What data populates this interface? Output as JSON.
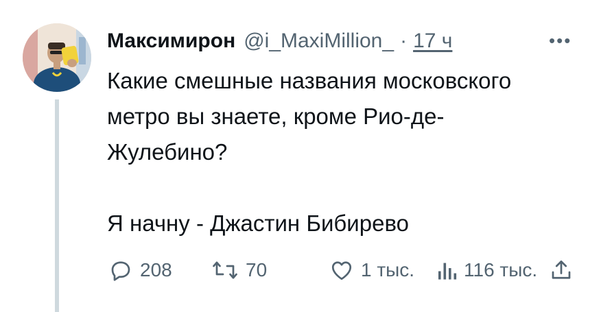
{
  "tweet": {
    "author_name": "Максимирон",
    "handle": "@i_MaxiMillion_",
    "separator": "·",
    "time": "17 ч",
    "more_label": "•••",
    "text_line1": "Какие смешные названия московского",
    "text_line2": "метро вы знаете, кроме Рио-де-",
    "text_line3": "Жулебино?",
    "text_line4": "Я начну - Джастин Бибирево"
  },
  "actions": {
    "replies": "208",
    "retweets": "70",
    "likes": "1 тыс.",
    "views": "116 тыс."
  },
  "colors": {
    "text": "#0f1419",
    "secondary": "#536471",
    "thread_line": "#cfd9de",
    "avatar_shirt": "#1e4e7a",
    "avatar_phone": "#f2d23a"
  },
  "icons": [
    "reply-icon",
    "retweet-icon",
    "like-icon",
    "views-icon",
    "share-icon"
  ]
}
